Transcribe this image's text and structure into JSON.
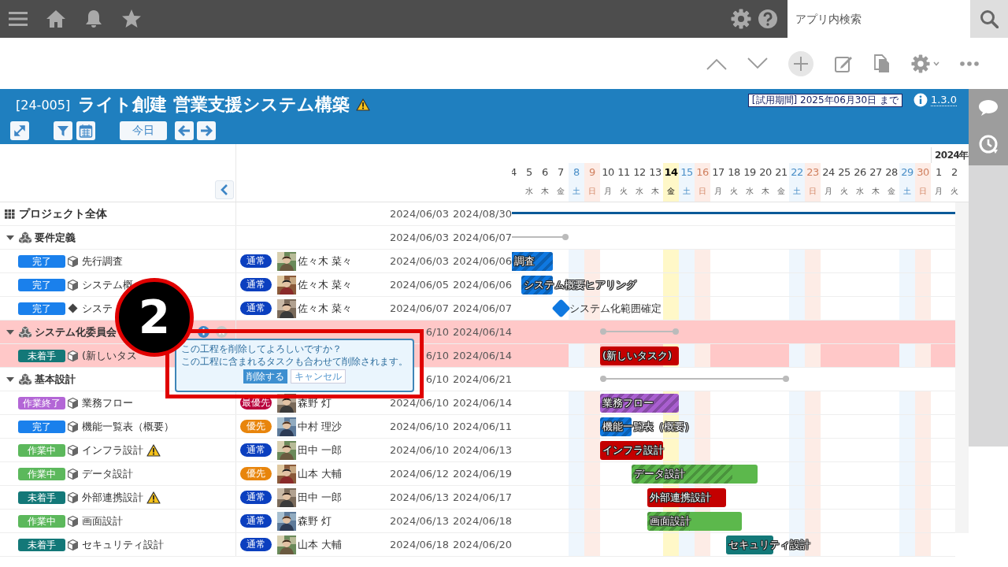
{
  "top_bar": {
    "search": {
      "placeholder": "アプリ内検索"
    }
  },
  "project_header": {
    "code": "[24-005]",
    "title": "ライト創建 営業支援システム構築",
    "warning": true,
    "trial_notice": "[試用期間] 2025年06月30日 まで",
    "version": "1.3.0",
    "today_button": "今日"
  },
  "timeline": {
    "days": [
      {
        "day": "4",
        "kind": "weekday"
      },
      {
        "day": "5",
        "weekday": "水",
        "kind": "weekday"
      },
      {
        "day": "6",
        "weekday": "木",
        "kind": "weekday"
      },
      {
        "day": "7",
        "weekday": "金",
        "kind": "weekday"
      },
      {
        "day": "8",
        "weekday": "土",
        "kind": "saturday"
      },
      {
        "day": "9",
        "weekday": "日",
        "kind": "sunday"
      },
      {
        "day": "10",
        "weekday": "月",
        "kind": "weekday"
      },
      {
        "day": "11",
        "weekday": "火",
        "kind": "weekday"
      },
      {
        "day": "12",
        "weekday": "水",
        "kind": "weekday"
      },
      {
        "day": "13",
        "weekday": "木",
        "kind": "weekday"
      },
      {
        "day": "14",
        "weekday": "金",
        "kind": "today"
      },
      {
        "day": "15",
        "weekday": "土",
        "kind": "saturday"
      },
      {
        "day": "16",
        "weekday": "日",
        "kind": "sunday"
      },
      {
        "day": "17",
        "weekday": "月",
        "kind": "weekday"
      },
      {
        "day": "18",
        "weekday": "火",
        "kind": "weekday"
      },
      {
        "day": "19",
        "weekday": "水",
        "kind": "weekday"
      },
      {
        "day": "20",
        "weekday": "木",
        "kind": "weekday"
      },
      {
        "day": "21",
        "weekday": "金",
        "kind": "weekday"
      },
      {
        "day": "22",
        "weekday": "土",
        "kind": "saturday"
      },
      {
        "day": "23",
        "weekday": "日",
        "kind": "sunday"
      },
      {
        "day": "24",
        "weekday": "月",
        "kind": "weekday"
      },
      {
        "day": "25",
        "weekday": "火",
        "kind": "weekday"
      },
      {
        "day": "26",
        "weekday": "水",
        "kind": "weekday"
      },
      {
        "day": "27",
        "weekday": "木",
        "kind": "weekday"
      },
      {
        "day": "28",
        "weekday": "金",
        "kind": "weekday"
      },
      {
        "day": "29",
        "weekday": "土",
        "kind": "saturday"
      },
      {
        "day": "30",
        "weekday": "日",
        "kind": "sunday"
      },
      {
        "day": "1",
        "weekday": "月",
        "kind": "weekday",
        "month_label": "2024年"
      },
      {
        "day": "2",
        "weekday": "火",
        "kind": "weekday"
      }
    ]
  },
  "rows": [
    {
      "kind": "project",
      "name": "プロジェクト全体",
      "start": "2024/06/03",
      "end": "2024/08/30"
    },
    {
      "kind": "phase",
      "name": "要件定義",
      "expanded": true,
      "start": "2024/06/03",
      "end": "2024/06/07"
    },
    {
      "kind": "task",
      "status": {
        "label": "完了",
        "color": "#1a80ec"
      },
      "name": "先行調査",
      "priority": {
        "label": "通常",
        "color": "#0b3fbf"
      },
      "assignee": "佐々木 菜々",
      "start": "2024/06/03",
      "end": "2024/06/06",
      "bar": {
        "label": "調査",
        "color": "#0f78e0",
        "level": 1
      }
    },
    {
      "kind": "task",
      "status": {
        "label": "完了",
        "color": "#1a80ec"
      },
      "name": "システム概",
      "priority": {
        "label": "通常",
        "color": "#0b3fbf"
      },
      "assignee": "佐々木 菜々",
      "start": "2024/06/05",
      "end": "2024/06/06",
      "bar": {
        "label": "システム概要ヒアリング",
        "color": "#0f78e0",
        "level": 1
      }
    },
    {
      "kind": "milestone",
      "status": {
        "label": "完了",
        "color": "#1a80ec"
      },
      "name": "システ",
      "priority": {
        "label": "通常",
        "color": "#0b3fbf"
      },
      "assignee": "佐々木 菜々",
      "start": "2024/06/07",
      "end": "2024/06/07",
      "bar": {
        "label": "システム化範囲確定",
        "color": "#0f78e0"
      }
    },
    {
      "kind": "phase",
      "name": "システム化委員会",
      "expanded": true,
      "show_actions": true,
      "start": "6/10",
      "end": "2024/06/14",
      "highlighted": true
    },
    {
      "kind": "task",
      "status": {
        "label": "未着手",
        "color": "#137878"
      },
      "name": "(新しいタス",
      "start": "6/10",
      "end": "2024/06/14",
      "highlighted": true,
      "bar": {
        "label": "(新しいタスク)",
        "color": "#c40000",
        "level": 0
      }
    },
    {
      "kind": "phase",
      "name": "基本設計",
      "expanded": true,
      "start": "6/10",
      "end": "2024/06/21"
    },
    {
      "kind": "task",
      "status": {
        "label": "作業終了",
        "color": "#b366d6"
      },
      "name": "業務フロー",
      "priority": {
        "label": "最優先",
        "color": "#b8003c"
      },
      "assignee": "森野 灯",
      "start": "2024/06/10",
      "end": "2024/06/14",
      "bar": {
        "label": "業務フロー",
        "color": "#a95fd0",
        "level": 1
      }
    },
    {
      "kind": "task",
      "status": {
        "label": "完了",
        "color": "#1a80ec"
      },
      "name": "機能一覧表（概要）",
      "priority": {
        "label": "優先",
        "color": "#e8850c"
      },
      "assignee": "中村 理沙",
      "start": "2024/06/10",
      "end": "2024/06/11",
      "bar": {
        "label": "機能一覧表（概要）",
        "color": "#0f78e0",
        "level": 1
      }
    },
    {
      "kind": "task",
      "status": {
        "label": "作業中",
        "color": "#5cb85c"
      },
      "name": "インフラ設計",
      "warning": true,
      "priority": {
        "label": "通常",
        "color": "#0b3fbf"
      },
      "assignee": "田中 一郎",
      "start": "2024/06/10",
      "end": "2024/06/13",
      "bar": {
        "label": "インフラ設計",
        "color": "#c40000",
        "level": 0
      }
    },
    {
      "kind": "task",
      "status": {
        "label": "作業中",
        "color": "#5cb85c"
      },
      "name": "データ設計",
      "priority": {
        "label": "優先",
        "color": "#e8850c"
      },
      "assignee": "山本 大輔",
      "start": "2024/06/12",
      "end": "2024/06/19",
      "bar": {
        "label": "データ設計",
        "color": "#5cb84c",
        "level": 0.8
      }
    },
    {
      "kind": "task",
      "status": {
        "label": "未着手",
        "color": "#137878"
      },
      "name": "外部連携設計",
      "warning": true,
      "priority": {
        "label": "通常",
        "color": "#0b3fbf"
      },
      "assignee": "田中 一郎",
      "start": "2024/06/13",
      "end": "2024/06/17",
      "bar": {
        "label": "外部連携設計",
        "color": "#c40000",
        "level": 0
      }
    },
    {
      "kind": "task",
      "status": {
        "label": "作業中",
        "color": "#5cb85c"
      },
      "name": "画面設計",
      "priority": {
        "label": "通常",
        "color": "#0b3fbf"
      },
      "assignee": "森野 灯",
      "start": "2024/06/13",
      "end": "2024/06/18",
      "bar": {
        "label": "画面設計",
        "color": "#5cb84c",
        "level": 0.45
      }
    },
    {
      "kind": "task",
      "status": {
        "label": "未着手",
        "color": "#137878"
      },
      "name": "セキュリティ設計",
      "priority": {
        "label": "通常",
        "color": "#0b3fbf"
      },
      "assignee": "山本 大輔",
      "start": "2024/06/18",
      "end": "2024/06/20",
      "bar": {
        "label": "セキュリティ設計",
        "color": "#137878",
        "level": 0
      }
    }
  ],
  "delete_dialog": {
    "lines": [
      "この工程を削除してよろしいですか？",
      "この工程に含まれるタスクも合わせて削除されます。"
    ],
    "confirm": "削除する",
    "cancel": "キャンセル"
  },
  "callout": {
    "number": "2"
  }
}
